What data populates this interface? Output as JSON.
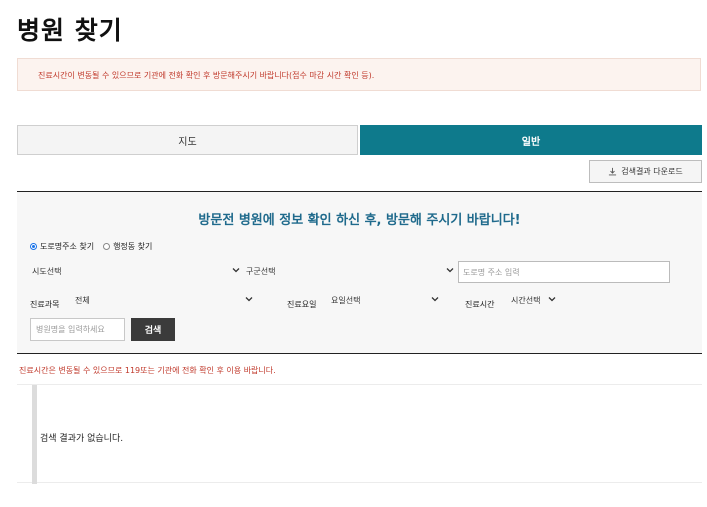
{
  "page": {
    "title": "병원 찾기"
  },
  "notice": {
    "text": "진료시간이 변동될 수 있으므로 기관에 전화 확인 후 방문해주시기 바랍니다(접수 마감 시간 확인 등)."
  },
  "tabs": [
    {
      "label": "지도",
      "active": false
    },
    {
      "label": "일반",
      "active": true
    }
  ],
  "toolbar": {
    "download_label": "검색결과 다운로드",
    "download_icon": "download-icon"
  },
  "search": {
    "heading": "방문전 병원에 정보 확인 하신 후, 방문해 주시기 바랍니다!",
    "radio_options": [
      {
        "label": "도로명주소 찾기",
        "checked": true
      },
      {
        "label": "행정동 찾기",
        "checked": false
      }
    ],
    "sido_select": "시도선택",
    "gugun_select": "구군선택",
    "address_placeholder": "도로명 주소 입력",
    "dept_label": "진료과목",
    "dept_select": "전체",
    "day_label": "진료요일",
    "day_select": "요일선택",
    "time_label": "진료시간",
    "time_select": "시간선택",
    "name_placeholder": "병원명을 입력하세요",
    "search_button": "검색"
  },
  "warning": {
    "text": "진료시간은 변동될 수 있으므로 119또는 기관에 전화 확인 후 이용 바랍니다."
  },
  "results": {
    "empty_message": "검색 결과가 없습니다."
  },
  "colors": {
    "accent": "#0e7a8c",
    "heading": "#1f6a8c",
    "warning": "#c0392b",
    "button_dark": "#3b3b3b"
  }
}
